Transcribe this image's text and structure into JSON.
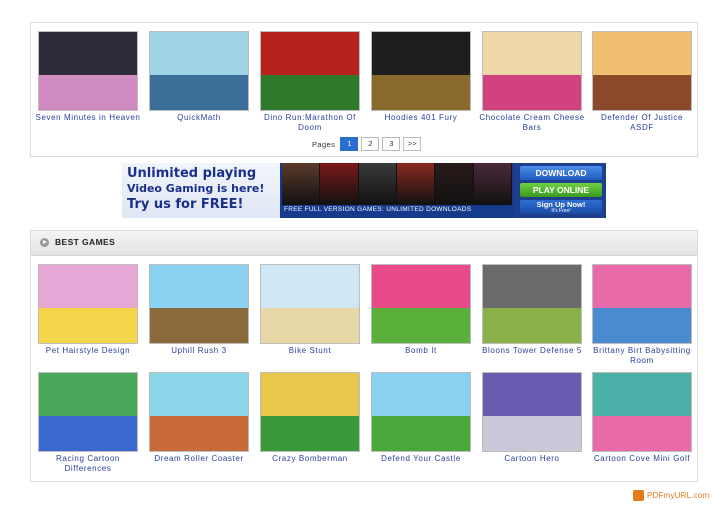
{
  "featured_games": [
    {
      "label": "Seven Minutes in Heaven",
      "thumb": [
        "#2b2b3a",
        "#d08bc0"
      ]
    },
    {
      "label": "QuickMath",
      "thumb": [
        "#9fd4e6",
        "#3b6f9a"
      ]
    },
    {
      "label": "Dino Run:Marathon Of Doom",
      "thumb": [
        "#b5221c",
        "#2f7a2a"
      ]
    },
    {
      "label": "Hoodies 401 Fury",
      "thumb": [
        "#1e1e1e",
        "#8a6a2c"
      ]
    },
    {
      "label": "Chocolate Cream Cheese Bars",
      "thumb": [
        "#f1d8a8",
        "#d1427e"
      ]
    },
    {
      "label": "Defender Of Justice ASDF",
      "thumb": [
        "#f0c070",
        "#8a4a2a"
      ]
    }
  ],
  "pager": {
    "label": "Pages",
    "pages": [
      "1",
      "2",
      "3"
    ],
    "next": ">>",
    "current": "1"
  },
  "banner": {
    "line1": "Unlimited playing",
    "line2": "Video Gaming is here!",
    "line3": "Try us for FREE!",
    "tagline": "FREE FULL VERSION GAMES: UNLIMITED DOWNLOADS",
    "btn_download": "DOWNLOAD",
    "btn_play": "PLAY ONLINE",
    "btn_signup": "Sign Up Now!",
    "btn_signup_sub": "It's Free!",
    "posters": [
      "#5a3a2a",
      "#7a1a1a",
      "#3a3a3a",
      "#8a2a20",
      "#2a1a1a",
      "#4a2a3a"
    ]
  },
  "best_games": {
    "title": "BEST GAMES",
    "row1": [
      {
        "label": "Pet Hairstyle Design",
        "thumb": [
          "#e6a6d6",
          "#f3d64a"
        ]
      },
      {
        "label": "Uphill Rush 3",
        "thumb": [
          "#8ad0f0",
          "#8a6a3a"
        ]
      },
      {
        "label": "Bike Stunt",
        "thumb": [
          "#cfe6f4",
          "#e8d8a8"
        ]
      },
      {
        "label": "Bomb It",
        "thumb": [
          "#e84a8a",
          "#5ab03a"
        ]
      },
      {
        "label": "Bloons Tower Defense 5",
        "thumb": [
          "#6a6a6a",
          "#8ab04a"
        ]
      },
      {
        "label": "Brittany Birt Babysitting Room",
        "thumb": [
          "#e86aa8",
          "#4a8ad0"
        ]
      }
    ],
    "row2": [
      {
        "label": "Racing Cartoon Differences",
        "thumb": [
          "#4aa85a",
          "#3a6ad0"
        ]
      },
      {
        "label": "Dream Roller Coaster",
        "thumb": [
          "#8ad6e8",
          "#c86a3a"
        ]
      },
      {
        "label": "Crazy Bomberman",
        "thumb": [
          "#e8c84a",
          "#3a9a3a"
        ]
      },
      {
        "label": "Defend Your Castle",
        "thumb": [
          "#8ad0f0",
          "#4aa83a"
        ]
      },
      {
        "label": "Cartoon Hero",
        "thumb": [
          "#6a5ab0",
          "#c8c8d8"
        ]
      },
      {
        "label": "Cartoon Cove Mini Golf",
        "thumb": [
          "#4ab0a8",
          "#e86aa8"
        ]
      }
    ]
  },
  "footer": {
    "brand": "PDFmyURL.com"
  }
}
